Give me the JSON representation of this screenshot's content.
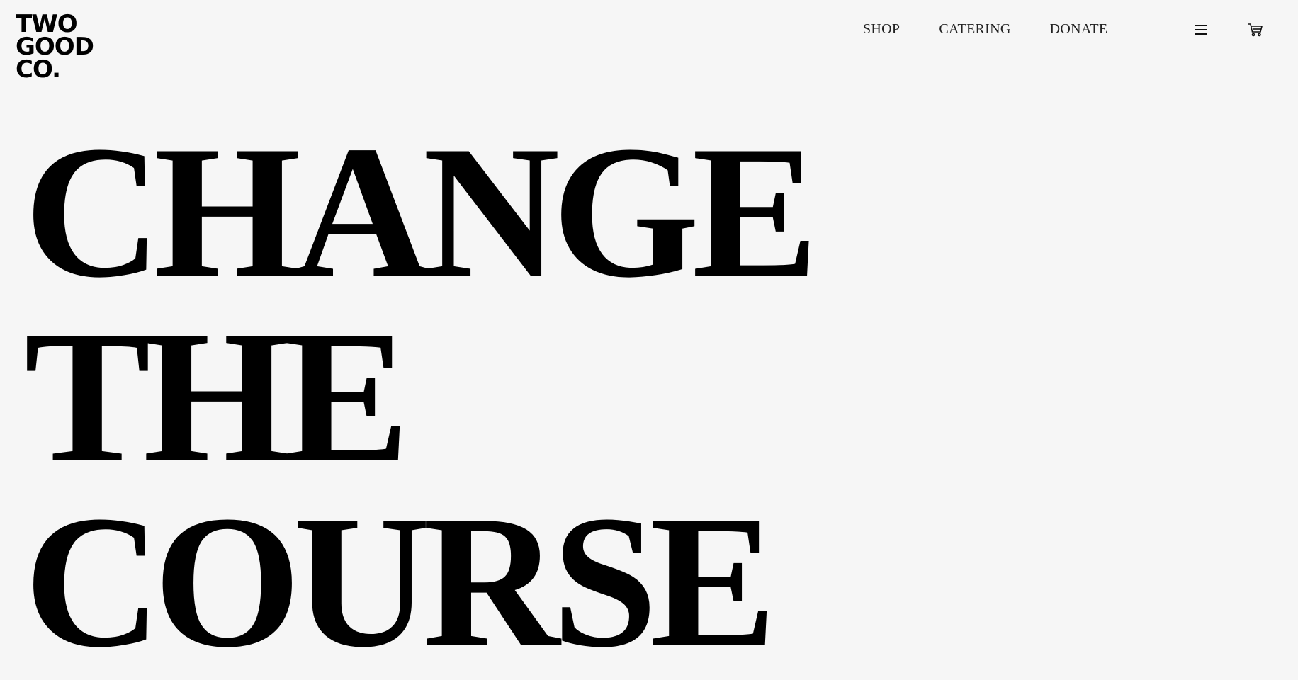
{
  "brand": {
    "logo_lines": [
      "TWO",
      "GOOD",
      "CO."
    ]
  },
  "nav": {
    "links": [
      "SHOP",
      "CATERING",
      "DONATE"
    ]
  },
  "icons": {
    "menu": "hamburger-menu-icon",
    "cart": "shopping-cart-icon"
  },
  "hero": {
    "lines": [
      "CHANGE",
      "THE",
      "COURSE"
    ]
  },
  "colors": {
    "background": "#f6f6f6",
    "text": "#000000"
  }
}
